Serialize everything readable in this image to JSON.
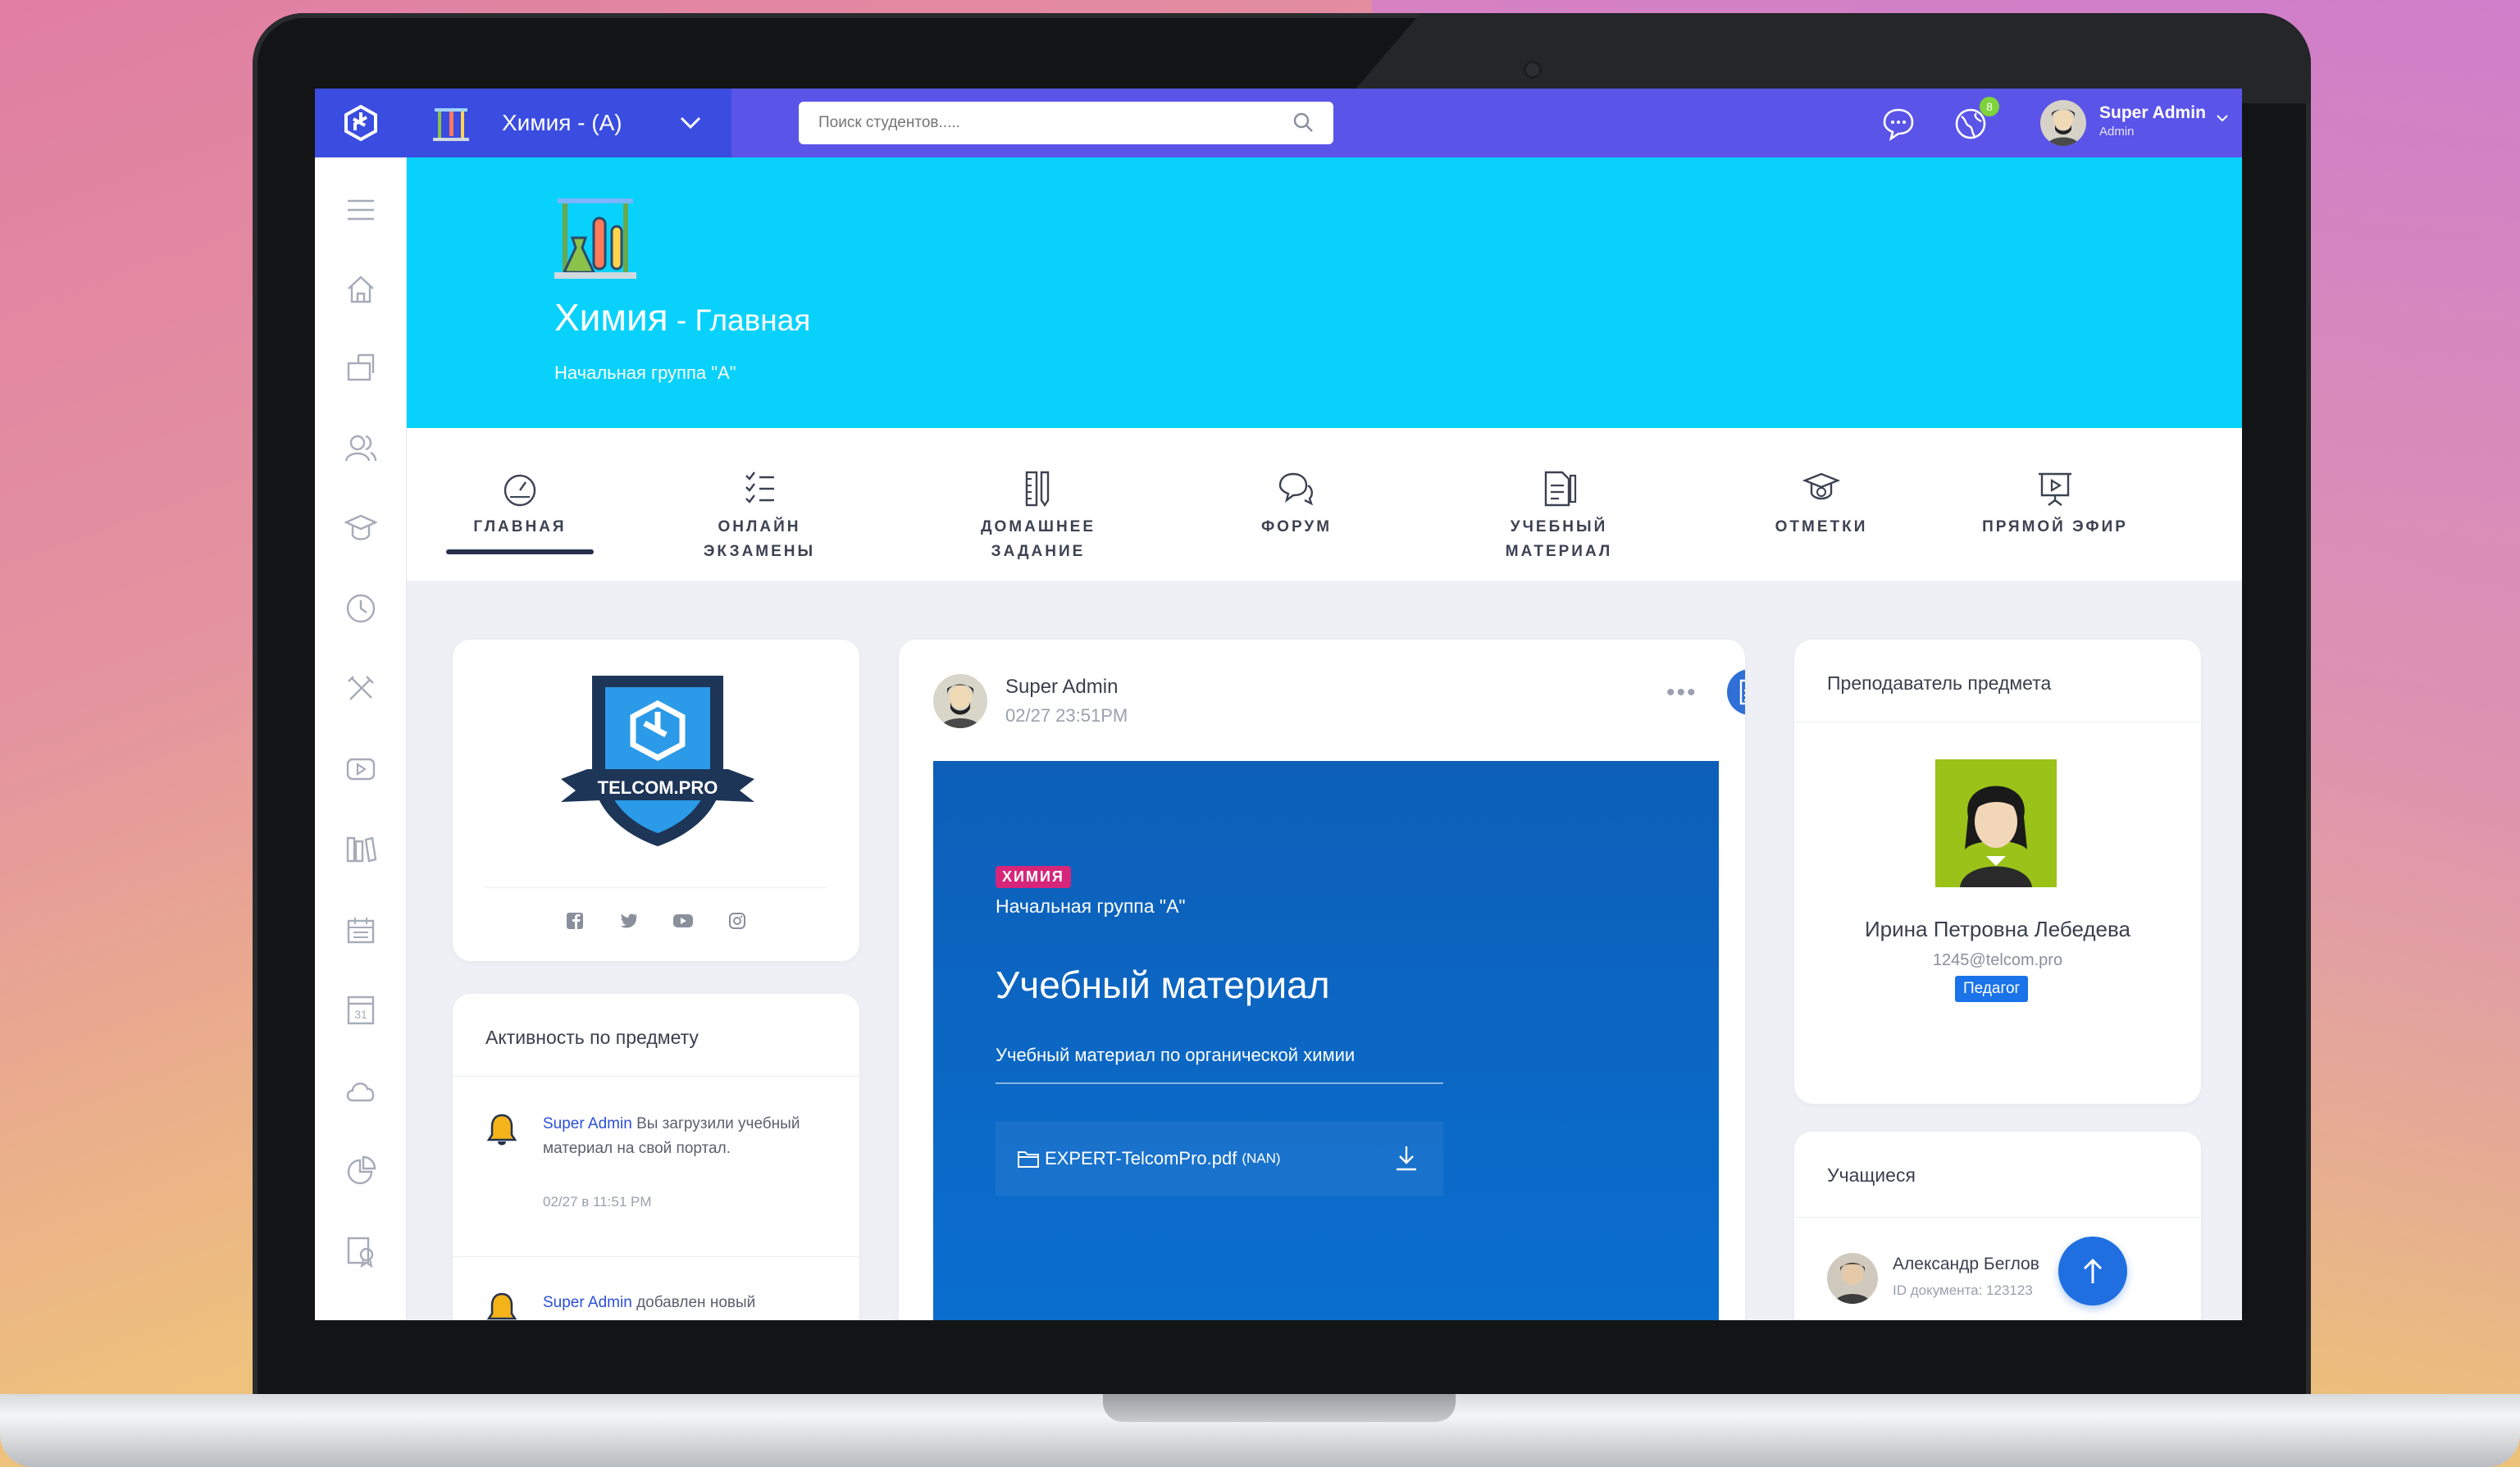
{
  "colors": {
    "accent": "#5b54e8",
    "hero": "#08d2fb",
    "tag": "#d6257a",
    "link": "#2c4fd7"
  },
  "topbar": {
    "course_title": "Химия - (A)",
    "search_placeholder": "Поиск студентов.....",
    "notification_count": "8",
    "user_name": "Super Admin",
    "user_role": "Admin"
  },
  "sidebar": {
    "items": [
      "menu-icon",
      "home-icon",
      "inbox-icon",
      "users-icon",
      "graduation-cap-icon",
      "clock-icon",
      "tools-icon",
      "video-icon",
      "library-icon",
      "calendar-icon",
      "date-icon",
      "cloud-icon",
      "chart-icon",
      "certificate-icon"
    ],
    "date_icon_label": "31"
  },
  "hero": {
    "title": "Химия",
    "title_suffix": " - Главная",
    "group": "Начальная группа \"A\""
  },
  "tabs": [
    {
      "line1": "ГЛАВНАЯ",
      "line2": ""
    },
    {
      "line1": "ОНЛАЙН",
      "line2": "ЭКЗАМЕНЫ"
    },
    {
      "line1": "ДОМАШНЕЕ",
      "line2": "ЗАДАНИЕ"
    },
    {
      "line1": "ФОРУМ",
      "line2": ""
    },
    {
      "line1": "УЧЕБНЫЙ",
      "line2": "МАТЕРИАЛ"
    },
    {
      "line1": "ОТМЕТКИ",
      "line2": ""
    },
    {
      "line1": "ПРЯМОЙ ЭФИР",
      "line2": ""
    }
  ],
  "school": {
    "logo_text": "TELCOM.PRO",
    "social": [
      "facebook-icon",
      "twitter-icon",
      "youtube-icon",
      "instagram-icon"
    ]
  },
  "activity": {
    "title": "Активность по предмету",
    "items": [
      {
        "user": "Super Admin",
        "text": " Вы загрузили учебный материал на свой портал.",
        "time": "02/27 в 11:51 PM"
      },
      {
        "user": "Super Admin",
        "text": " добавлен новый",
        "time": ""
      }
    ]
  },
  "post": {
    "author": "Super Admin",
    "time": "02/27 23:51PM",
    "more": "•••",
    "tag": "ХИМИЯ",
    "group": "Начальная группа \"A\"",
    "title": "Учебный материал",
    "description": "Учебный материал по органической химии",
    "file_name": "EXPERT-TelcomPro.pdf",
    "file_size": "(NAN)"
  },
  "teacher": {
    "title": "Преподаватель предмета",
    "name": "Ирина Петровна Лебедева",
    "email": "1245@telcom.pro",
    "role": "Педагог"
  },
  "students": {
    "title": "Учащиеся",
    "items": [
      {
        "name": "Александр Беглов",
        "id": "ID документа: 123123"
      }
    ]
  }
}
